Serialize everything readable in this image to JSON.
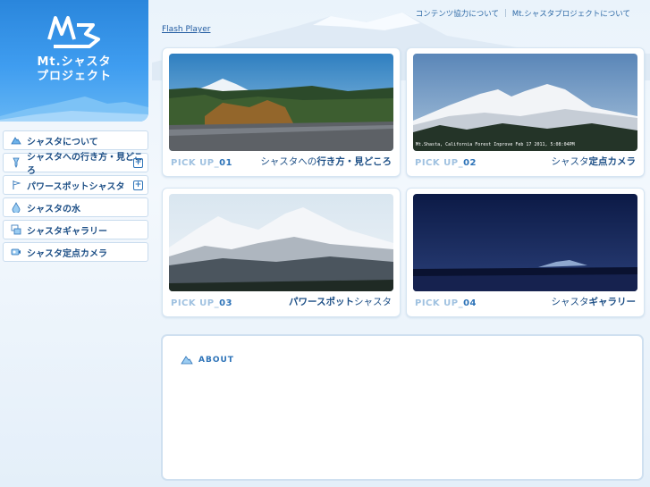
{
  "logo": {
    "line1": "Mt.シャスタ",
    "line2": "プロジェクト"
  },
  "header": {
    "links": [
      "コンテンツ協力について",
      "Mt.シャスタプロジェクトについて"
    ],
    "separator": "|",
    "flash": "Flash Player"
  },
  "nav": {
    "items": [
      {
        "label": "シャスタについて",
        "icon": "mountain-icon",
        "expandable": false
      },
      {
        "label": "シャスタへの行き方・見どころ",
        "icon": "pin-icon",
        "expandable": true
      },
      {
        "label": "パワースポットシャスタ",
        "icon": "flag-icon",
        "expandable": true
      },
      {
        "label": "シャスタの水",
        "icon": "water-drop-icon",
        "expandable": false
      },
      {
        "label": "シャスタギャラリー",
        "icon": "gallery-icon",
        "expandable": false
      },
      {
        "label": "シャスタ定点カメラ",
        "icon": "camera-icon",
        "expandable": false
      }
    ],
    "expand_symbol": "+"
  },
  "cards": [
    {
      "pick_prefix": "PICK UP_",
      "pick_num": "01",
      "title_light": "シャスタへの",
      "title_bold": "行き方・見どころ"
    },
    {
      "pick_prefix": "PICK UP_",
      "pick_num": "02",
      "title_light": "シャスタ",
      "title_bold": "定点カメラ"
    },
    {
      "pick_prefix": "PICK UP_",
      "pick_num": "03",
      "title_light": "シャスタ",
      "title_bold": "パワースポット",
      "bold_first": true
    },
    {
      "pick_prefix": "PICK UP_",
      "pick_num": "04",
      "title_light": "シャスタ",
      "title_bold": "ギャラリー"
    }
  ],
  "webcam_caption": "Mt.Shasta, California  Forest Inprove Feb 17 2011, 5:08:04PM",
  "about": {
    "label": "ABOUT"
  },
  "colors": {
    "accent": "#2d73b8",
    "logo_blue": "#3f9df0",
    "text_dark": "#1d4f86"
  }
}
